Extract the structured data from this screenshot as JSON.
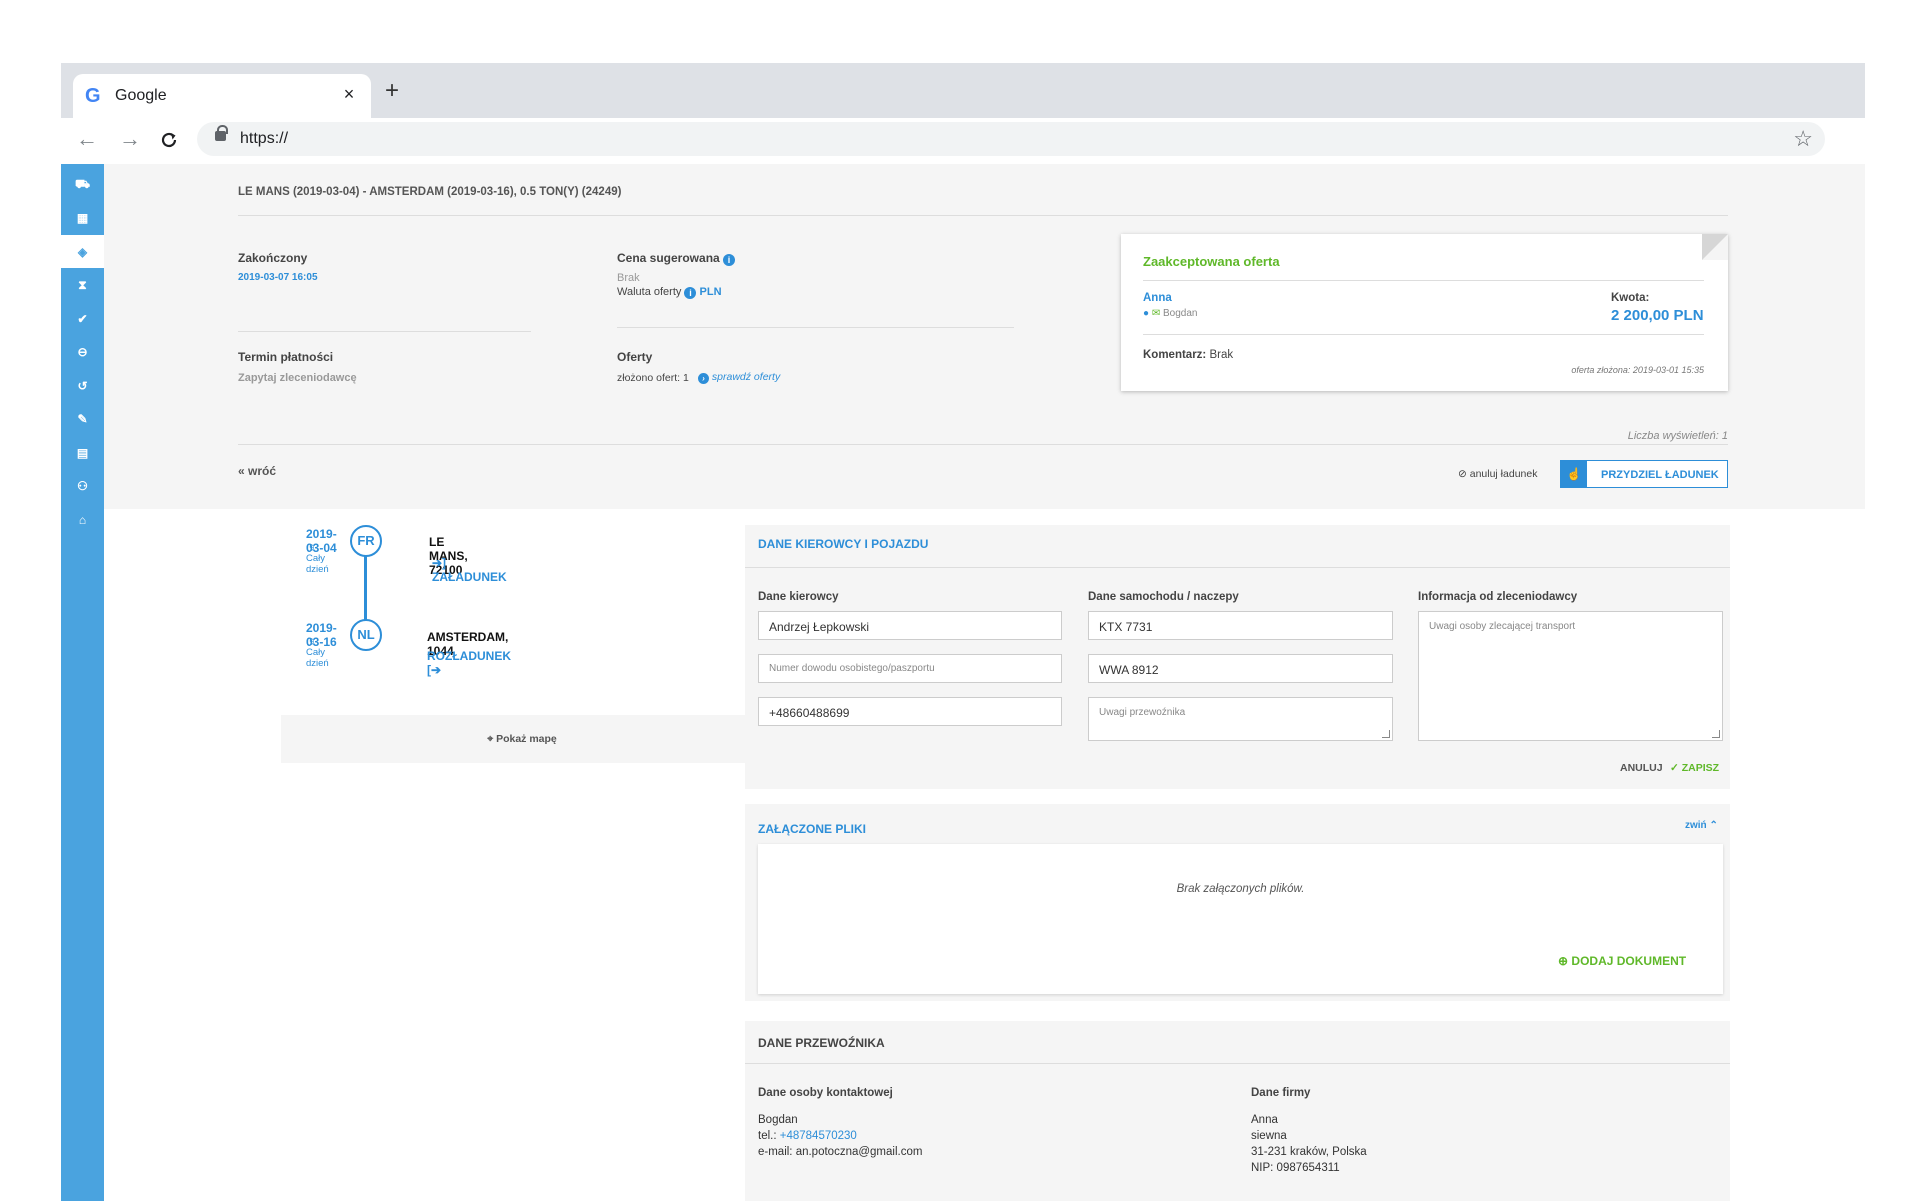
{
  "browser": {
    "tab_title": "Google",
    "tab_close": "×",
    "new_tab": "+",
    "url": "https://",
    "back": "←",
    "forward": "→",
    "reload": "C",
    "star": "☆"
  },
  "sidebar": {
    "items": [
      "truck-icon",
      "warehouse-icon",
      "cube-icon",
      "hourglass-icon",
      "check-circle-icon",
      "minus-circle-icon",
      "undo-icon",
      "edit-icon",
      "clipboard-icon",
      "users-icon",
      "home-icon"
    ],
    "active_index": 2,
    "color": "#4aa3df"
  },
  "order": {
    "header": "LE MANS (2019-03-04) - AMSTERDAM (2019-03-16), 0.5 TON(Y) (24249)",
    "status_label": "Zakończony",
    "status_date": "2019-03-07 16:05",
    "suggested_price_label": "Cena sugerowana",
    "suggested_price_value": "Brak",
    "currency_label": "Waluta oferty",
    "currency_value": "PLN",
    "payment_label": "Termin płatności",
    "payment_value": "Zapytaj zleceniodawcę",
    "offers_label": "Oferty",
    "offers_count": "złożono ofert: 1",
    "check_offers": "sprawdź oferty",
    "views": "Liczba wyświetleń: 1",
    "back": "wróć",
    "cancel_load": "anuluj ładunek",
    "assign_load": "PRZYDZIEL ŁADUNEK"
  },
  "accepted_offer": {
    "title": "Zaakceptowana oferta",
    "company": "Anna",
    "person": "Bogdan",
    "amount_label": "Kwota:",
    "amount": "2 200,00 PLN",
    "comment_label": "Komentarz:",
    "comment": "Brak",
    "submitted": "oferta złożona: 2019-03-01 15:35"
  },
  "route": {
    "stops": [
      {
        "date": "2019-03-04",
        "time": "Cały dzień",
        "country": "FR",
        "place": "LE MANS, 72100",
        "action": "ZAŁADUNEK"
      },
      {
        "date": "2019-03-16",
        "time": "Cały dzień",
        "country": "NL",
        "place": "AMSTERDAM, 1044",
        "action": "ROZŁADUNEK"
      }
    ],
    "show_map": "Pokaż mapę"
  },
  "driver_panel": {
    "title": "DANE KIEROWCY I POJAZDU",
    "driver_label": "Dane kierowcy",
    "driver_name": "Andrzej Łepkowski",
    "id_placeholder": "Numer dowodu osobistego/paszportu",
    "phone": "+48660488699",
    "vehicle_label": "Dane samochodu / naczepy",
    "truck_plate": "KTX 7731",
    "trailer_plate": "WWA 8912",
    "carrier_notes_placeholder": "Uwagi przewoźnika",
    "client_info_label": "Informacja od zleceniodawcy",
    "client_info_placeholder": "Uwagi osoby zlecającej transport",
    "cancel": "ANULUJ",
    "save": "ZAPISZ"
  },
  "files_panel": {
    "title": "ZAŁĄCZONE PLIKI",
    "collapse": "zwiń",
    "empty": "Brak załączonych plików.",
    "add_document": "DODAJ DOKUMENT"
  },
  "carrier_panel": {
    "title": "DANE PRZEWOŹNIKA",
    "contact_label": "Dane osoby kontaktowej",
    "contact_name": "Bogdan",
    "tel_label": "tel.:",
    "tel": "+48784570230",
    "email": "e-mail: an.potoczna@gmail.com",
    "company_label": "Dane firmy",
    "company_name": "Anna",
    "company_line2": "siewna",
    "company_address": "31-231 kraków, Polska",
    "company_nip": "NIP: 0987654311"
  }
}
